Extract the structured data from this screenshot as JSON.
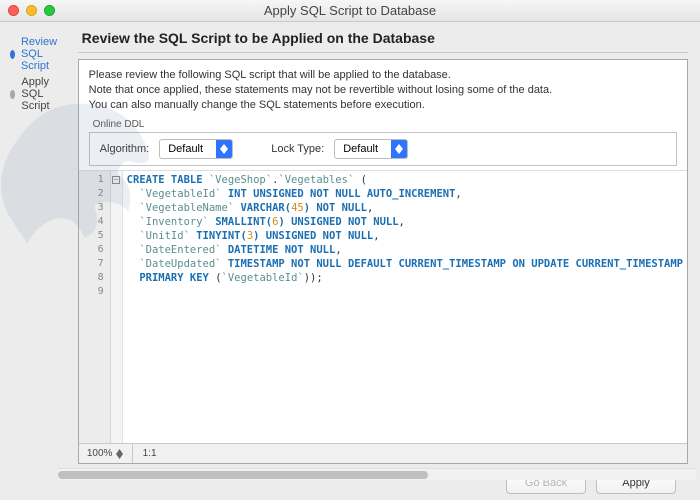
{
  "window": {
    "title": "Apply SQL Script to Database"
  },
  "sidebar": {
    "steps": [
      {
        "label": "Review SQL Script",
        "active": true
      },
      {
        "label": "Apply SQL Script",
        "active": false
      }
    ]
  },
  "heading": "Review the SQL Script to be Applied on the Database",
  "description": {
    "l1": "Please review the following SQL script that will be applied to the database.",
    "l2": "Note that once applied, these statements may not be revertible without losing some of the data.",
    "l3": "You can also manually change the SQL statements before execution."
  },
  "ddl": {
    "legend": "Online DDL",
    "algorithm_label": "Algorithm:",
    "algorithm_value": "Default",
    "locktype_label": "Lock Type:",
    "locktype_value": "Default"
  },
  "lineNumbers": [
    "1",
    "2",
    "3",
    "4",
    "5",
    "6",
    "7",
    "8",
    "9"
  ],
  "sql": {
    "schema": "`VegeShop`",
    "table": "`Vegetables`",
    "cols": {
      "id": {
        "name": "`VegetableId`",
        "type": "INT UNSIGNED NOT NULL AUTO_INCREMENT"
      },
      "name": {
        "name": "`VegetableName`",
        "type_a": "VARCHAR(",
        "len": "45",
        "type_b": ") NOT NULL"
      },
      "inv": {
        "name": "`Inventory`",
        "type_a": "SMALLINT(",
        "len": "6",
        "type_b": ") UNSIGNED NOT NULL"
      },
      "unit": {
        "name": "`UnitId`",
        "type_a": "TINYINT(",
        "len": "3",
        "type_b": ") UNSIGNED NOT NULL"
      },
      "de": {
        "name": "`DateEntered`",
        "type": "DATETIME NOT NULL"
      },
      "du": {
        "name": "`DateUpdated`",
        "type": "TIMESTAMP NOT NULL DEFAULT CURRENT_TIMESTAMP ON UPDATE CURRENT_TIMESTAMP"
      }
    },
    "pk_kw": "PRIMARY KEY",
    "pk_col": "`VegetableId`",
    "create_kw": "CREATE TABLE"
  },
  "status": {
    "zoom": "100%",
    "ratio": "1:1"
  },
  "footer": {
    "back": "Go Back",
    "apply": "Apply"
  }
}
